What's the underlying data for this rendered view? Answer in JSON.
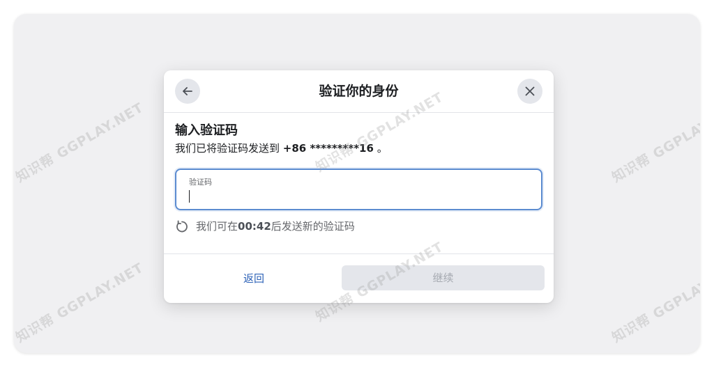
{
  "watermark": {
    "text": "知识帮 GGPLAY.NET"
  },
  "dialog": {
    "title": "验证你的身份",
    "heading": "输入验证码",
    "sent_prefix": "我们已将验证码发送到 ",
    "phone": "+86 *********16",
    "sent_suffix": " 。",
    "input": {
      "label": "验证码",
      "value": ""
    },
    "timer": {
      "prefix": "我们可在 ",
      "countdown": "00:42",
      "suffix": " 后发送新的验证码"
    },
    "back_label": "返回",
    "continue_label": "继续"
  },
  "colors": {
    "link": "#2d62b7",
    "input_focus_border": "#5b8bd0",
    "disabled_button_bg": "#e4e6eb"
  },
  "icons": {
    "back": "arrow-left-icon",
    "close": "close-icon",
    "timer": "refresh-icon"
  }
}
